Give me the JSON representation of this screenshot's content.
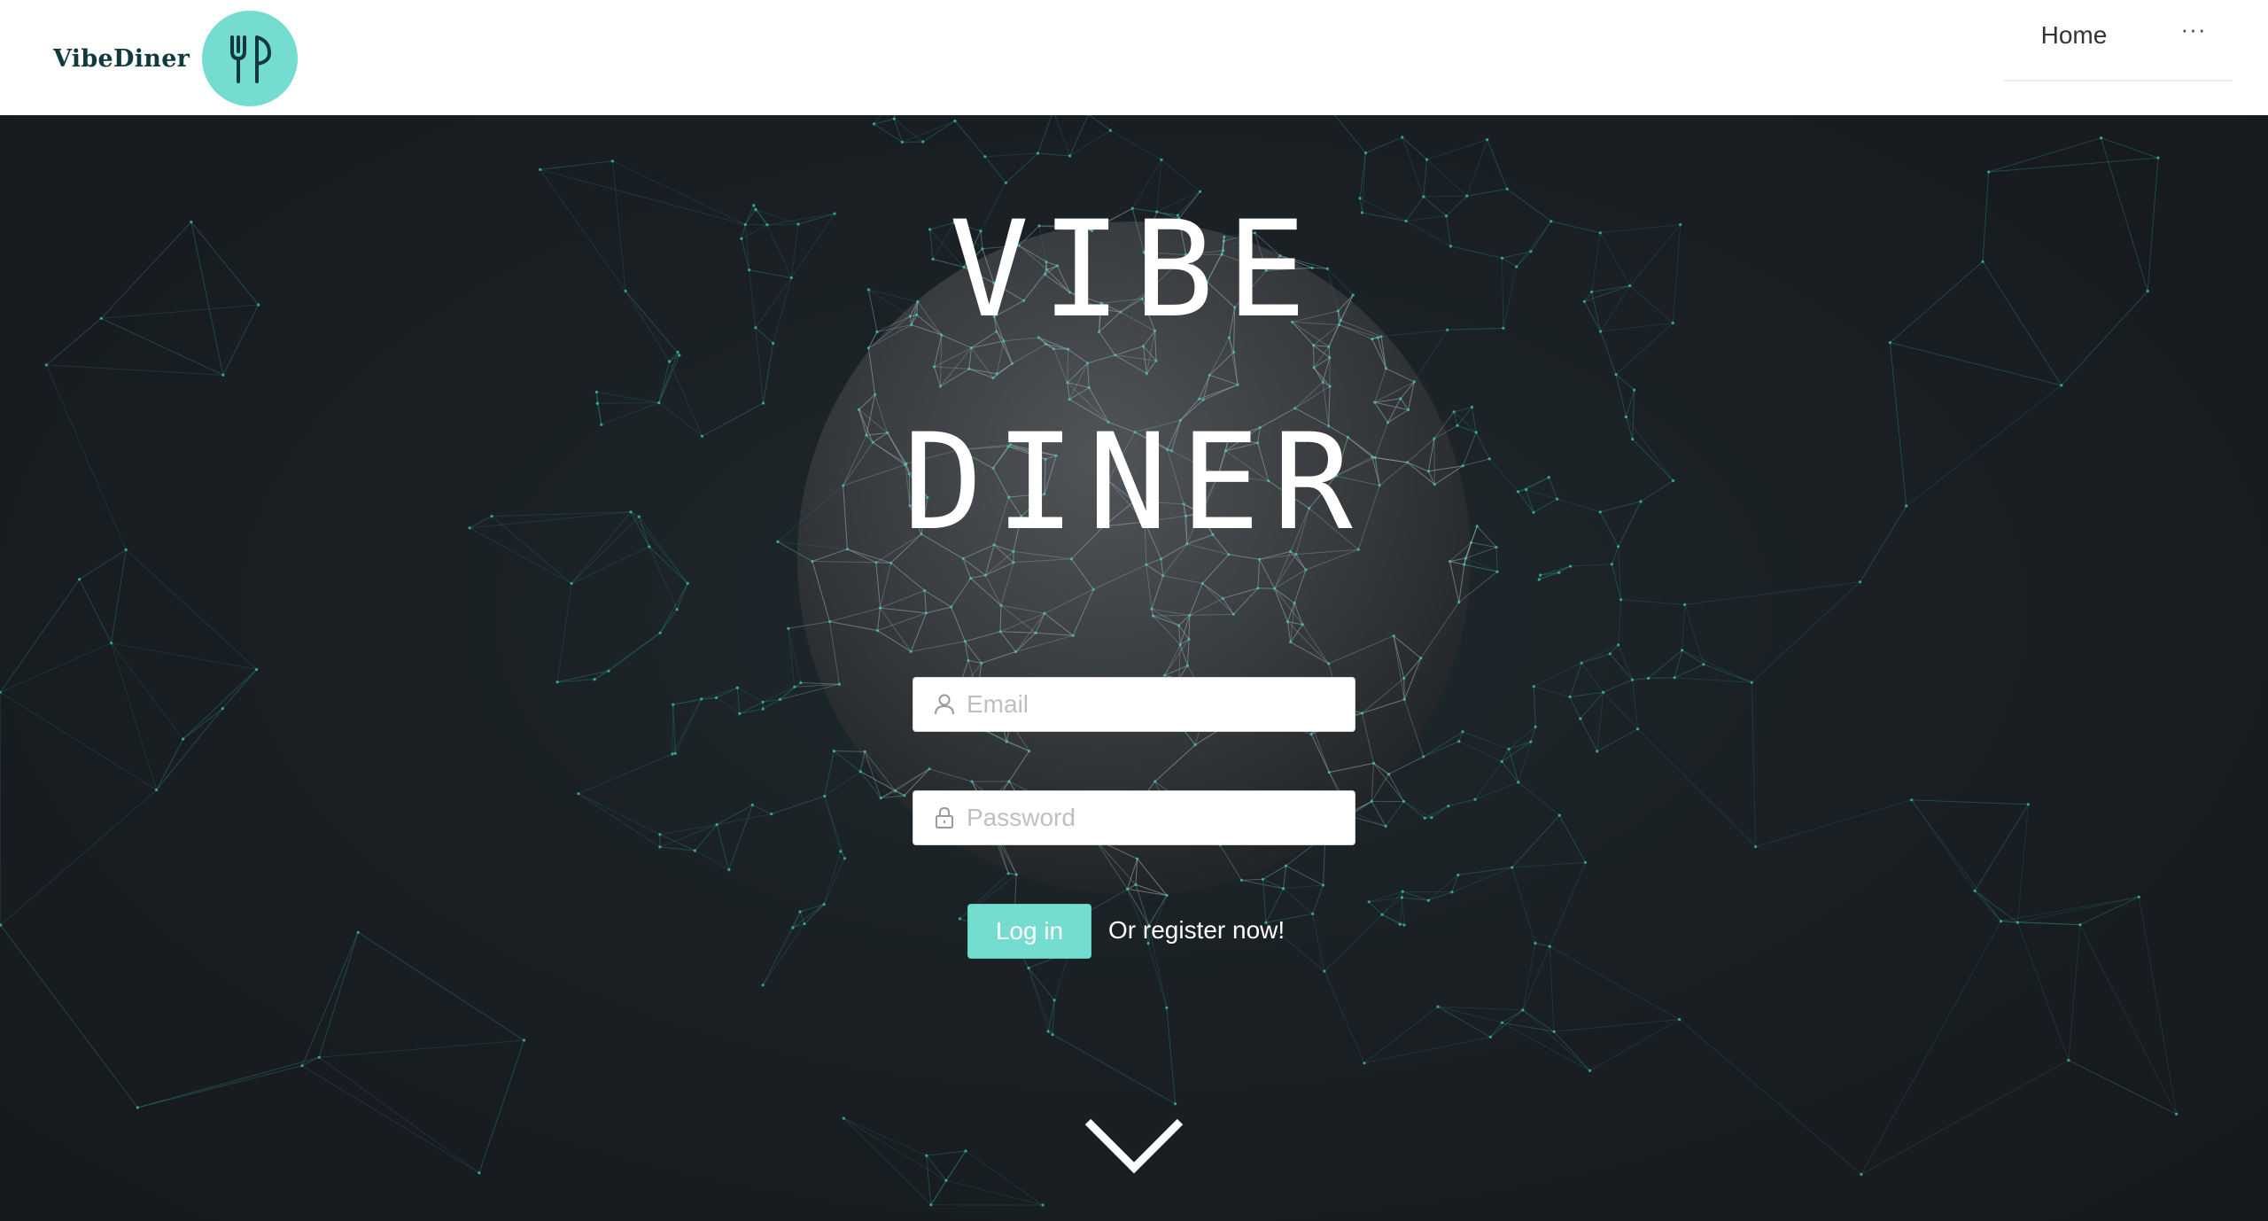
{
  "header": {
    "brand_name": "VibeDiner",
    "nav": {
      "home_label": "Home",
      "more_label": "···"
    }
  },
  "hero": {
    "title_line1": "VIBE",
    "title_line2": "DINER",
    "email": {
      "placeholder": "Email",
      "value": ""
    },
    "password": {
      "placeholder": "Password",
      "value": ""
    },
    "login_label": "Log in",
    "register_label": "Or register now!"
  },
  "colors": {
    "accent": "#74ddcf",
    "brand_text": "#123a3e",
    "hero_bg": "#1a2024",
    "network_line": "#2e8c86"
  },
  "icons": {
    "brand_logo": "fork-knife-icon",
    "email": "user-icon",
    "password": "lock-icon",
    "scroll": "chevron-down-icon"
  }
}
